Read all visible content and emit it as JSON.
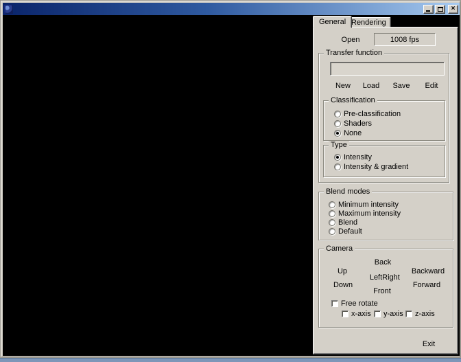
{
  "window": {
    "title": "",
    "controls": {
      "close_glyph": "×"
    }
  },
  "tabs": [
    {
      "label": "General",
      "active": true
    },
    {
      "label": "Rendering",
      "active": false
    }
  ],
  "general_tab": {
    "open_button": "Open",
    "fps_display": "1008 fps",
    "transfer_function": {
      "title": "Transfer function",
      "input_value": "",
      "buttons": {
        "new": "New",
        "load": "Load",
        "save": "Save",
        "edit": "Edit"
      },
      "classification": {
        "title": "Classification",
        "options": [
          {
            "label": "Pre-classification",
            "selected": false
          },
          {
            "label": "Shaders",
            "selected": false
          },
          {
            "label": "None",
            "selected": true
          }
        ]
      },
      "type": {
        "title": "Type",
        "options": [
          {
            "label": "Intensity",
            "selected": true
          },
          {
            "label": "Intensity & gradient",
            "selected": false
          }
        ]
      }
    },
    "blend_modes": {
      "title": "Blend modes",
      "options": [
        {
          "label": "Minimum intensity",
          "selected": false
        },
        {
          "label": "Maximum intensity",
          "selected": false
        },
        {
          "label": "Blend",
          "selected": false
        },
        {
          "label": "Default",
          "selected": false
        }
      ]
    },
    "camera": {
      "title": "Camera",
      "buttons": {
        "up": "Up",
        "down": "Down",
        "back": "Back",
        "left": "Left",
        "right": "Right",
        "front": "Front",
        "backward": "Backward",
        "forward": "Forward"
      },
      "free_rotate": {
        "label": "Free rotate",
        "checked": false
      },
      "axes": [
        {
          "label": "x-axis",
          "checked": false
        },
        {
          "label": "y-axis",
          "checked": false
        },
        {
          "label": "z-axis",
          "checked": false
        }
      ]
    },
    "exit_button": "Exit"
  },
  "colors": {
    "button_face": "#d4d0c8",
    "titlebar_gradient_start": "#0a246a",
    "titlebar_gradient_end": "#a6caf0",
    "viewport_background": "#000000",
    "desktop_strip": "#7d96b8"
  }
}
